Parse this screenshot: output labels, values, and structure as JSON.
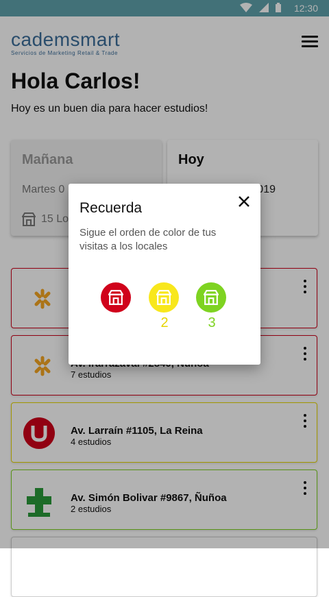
{
  "statusbar": {
    "time": "12:30"
  },
  "brand": {
    "name": "cademsmart",
    "tagline": "Servicios de Marketing Retail & Trade",
    "color": "#3c6e9a"
  },
  "greeting": {
    "title": "Hola Carlos!",
    "subtitle": "Hoy es un buen dia para hacer estudios!"
  },
  "days": [
    {
      "title": "Mañana",
      "date": "Martes  0",
      "stores": "15 Lo"
    },
    {
      "title": "Hoy",
      "date": "019"
    }
  ],
  "stores": [
    {
      "address": "",
      "studies": "",
      "status_color": "#d0021b",
      "logo": "walmart-icon"
    },
    {
      "address": "Av. Irarrázaval #2840, Ñuñoa",
      "studies": "7 estudios",
      "status_color": "#d0021b",
      "logo": "walmart-icon"
    },
    {
      "address": "Av. Larraín #1105, La Reina",
      "studies": "4 estudios",
      "status_color": "#e8d800",
      "logo": "unimarc-icon"
    },
    {
      "address": "Av. Simón Bolivar #9867, Ñuñoa",
      "studies": "2 estudios",
      "status_color": "#7ed321",
      "logo": "cruz-verde-icon"
    }
  ],
  "dialog": {
    "title": "Recuerda",
    "body": "Sigue el orden de color de tus visitas a los locales",
    "steps": [
      {
        "label": "",
        "color": "#d0021b"
      },
      {
        "label": "2",
        "color": "#f8e71c"
      },
      {
        "label": "3",
        "color": "#7ed321"
      }
    ]
  },
  "colors": {
    "accent": "#5fa2ad",
    "red": "#d0021b",
    "yellow": "#f8e71c",
    "green": "#7ed321"
  }
}
